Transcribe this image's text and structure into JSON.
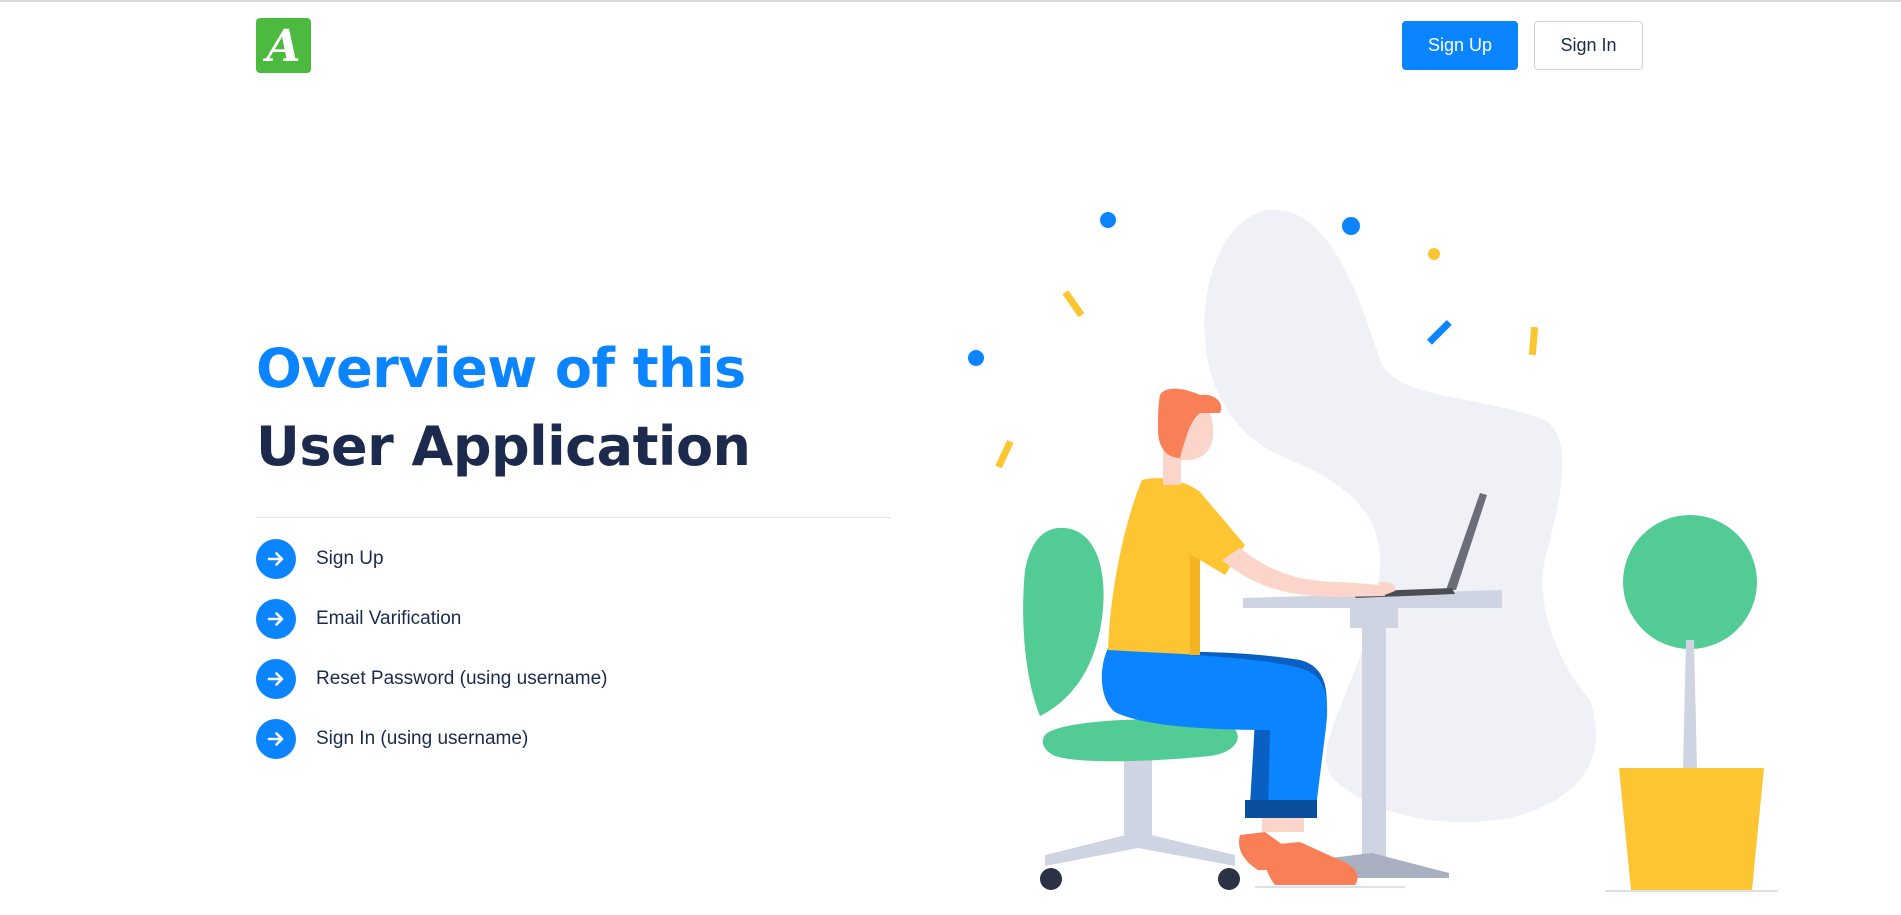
{
  "header": {
    "logo_icon": "app-logo-icon",
    "logo_glyph": "A",
    "signup_label": "Sign Up",
    "signin_label": "Sign In"
  },
  "hero": {
    "title_accent": "Overview of this",
    "title_rest": "User Application"
  },
  "features": [
    {
      "icon": "arrow-right-icon",
      "label": "Sign Up"
    },
    {
      "icon": "arrow-right-icon",
      "label": "Email Varification"
    },
    {
      "icon": "arrow-right-icon",
      "label": "Reset Password (using username)"
    },
    {
      "icon": "arrow-right-icon",
      "label": "Sign In (using username)"
    }
  ],
  "colors": {
    "accent": "#0a84ff",
    "heading": "#1b2a4d",
    "logo": "#4cba3f",
    "yellow": "#fdc532",
    "green": "#52cb94"
  }
}
